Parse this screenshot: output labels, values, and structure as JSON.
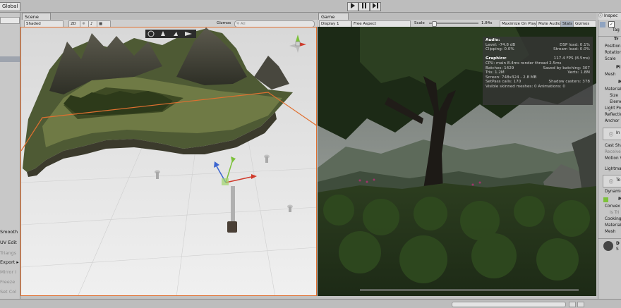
{
  "toolbar": {
    "pivot_label": "Global",
    "play_icon": "play-icon",
    "pause_icon": "pause-icon",
    "step_icon": "step-icon"
  },
  "left_panel": {
    "items": [
      "Smooth",
      "UV Edit",
      "Triangs",
      "Export",
      "Mirror I",
      "Freeze",
      "Set Col"
    ],
    "enabled": [
      true,
      true,
      false,
      true,
      false,
      false,
      false
    ]
  },
  "scene": {
    "tab_label": "Scene",
    "shading": "Shaded",
    "mode_2d": "2D",
    "gizmos": "Gizmos",
    "search_placeholder": "All"
  },
  "game": {
    "tab_label": "Game",
    "display": "Display 1",
    "aspect": "Free Aspect",
    "scale_label": "Scale",
    "scale_value": "1.84x",
    "maximize": "Maximize On Play",
    "mute": "Mute Audio",
    "stats": "Stats",
    "gizmos": "Gizmos"
  },
  "stats": {
    "audio_header": "Audio:",
    "level": "Level: -74.8 dB",
    "dsp": "DSP load: 0.1%",
    "clipping": "Clipping: 0.0%",
    "stream": "Stream load: 0.0%",
    "graphics_header": "Graphics:",
    "fps": "117.4 FPS (8.5ms)",
    "cpu": "CPU: main 8.4ms  render thread 2.5ms",
    "batches": "Batches: 1429",
    "saved": "Saved by batching: 307",
    "tris": "Tris: 1.2M",
    "verts": "Verts: 1.8M",
    "screen": "Screen: 748x324 - 2.8 MB",
    "setpass": "SetPass calls: 170",
    "shadow": "Shadow casters: 378",
    "skinned": "Visible skinned meshes: 0  Animations: 0"
  },
  "inspector": {
    "tab_label": "Inspec",
    "tag": "Tag",
    "transform": "Tr",
    "position": "Position",
    "rotation": "Rotation",
    "scale": "Scale",
    "pl": "Pl",
    "mesh": "Mesh",
    "mr_header": "M",
    "materials": "Materials",
    "size": "Size",
    "element": "Eleme",
    "light_probes": "Light Pro",
    "reflection": "Reflectio",
    "anchor": "Anchor",
    "info": "In",
    "cast_shadows": "Cast Sha",
    "receive": "Receive",
    "motion": "Motion V",
    "lightmap": "Lightmap",
    "to": "To",
    "dynamic": "Dynamic",
    "mc_header": "M",
    "convex": "Convex",
    "is_trigger": "Is Tri",
    "cooking": "Cooking",
    "material": "Material",
    "mesh2": "Mesh",
    "asset": "D",
    "asset_sub": "S"
  }
}
